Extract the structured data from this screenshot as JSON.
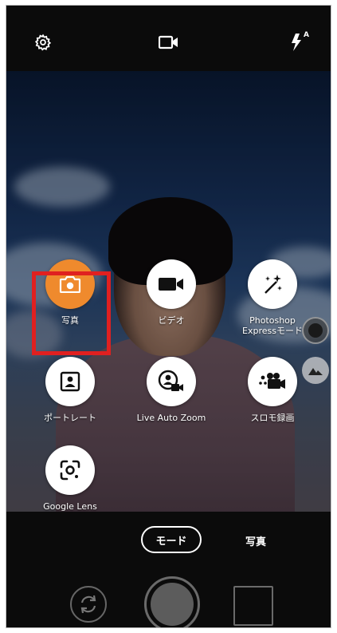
{
  "topbar": {
    "icons": [
      "gear-icon",
      "video-camera-icon",
      "flash-auto-icon"
    ],
    "flash_badge": "A"
  },
  "modes": {
    "items": [
      {
        "label": "写真",
        "icon": "camera-icon",
        "active": true
      },
      {
        "label": "ビデオ",
        "icon": "video-camera-icon",
        "active": false
      },
      {
        "label": "Photoshop\nExpressモード",
        "icon": "magic-sparkle-icon",
        "active": false
      },
      {
        "label": "ポートレート",
        "icon": "portrait-icon",
        "active": false
      },
      {
        "label": "Live Auto Zoom",
        "icon": "person-zoom-icon",
        "active": false
      },
      {
        "label": "スロモ録画",
        "icon": "slow-motion-icon",
        "active": false
      },
      {
        "label": "Google Lens",
        "icon": "google-lens-icon",
        "active": false
      }
    ],
    "highlighted": "ポートレート",
    "highlight_color": "#e02020",
    "active_color": "#ef8a2d"
  },
  "side": {
    "icons": [
      "shutter-record-icon",
      "landscape-icon"
    ]
  },
  "bottom": {
    "mode_button_label": "モード",
    "current_mode_label": "写真",
    "icons": [
      "switch-camera-icon",
      "shutter-button",
      "gallery-thumbnail"
    ]
  }
}
